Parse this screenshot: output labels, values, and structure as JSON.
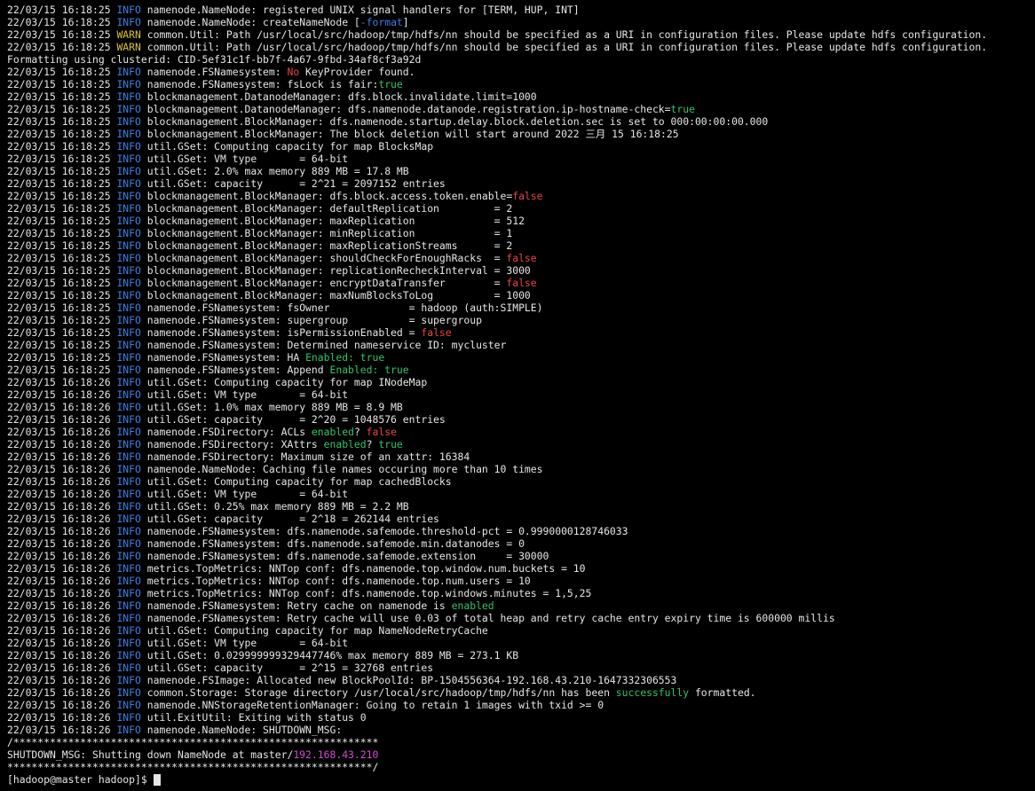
{
  "colors": {
    "background": "#000000",
    "text": "#e6e6e6",
    "info": "#3d7fe0",
    "warn": "#d8c43c",
    "true": "#2fc46a",
    "false": "#e64545",
    "ip": "#d24cd6"
  },
  "terminal": {
    "lines": [
      [
        {
          "t": "22/03/15 16:18:25 "
        },
        {
          "t": "INFO",
          "c": "info"
        },
        {
          "t": " namenode.NameNode: registered UNIX signal handlers for [TERM, HUP, INT]"
        }
      ],
      [
        {
          "t": "22/03/15 16:18:25 "
        },
        {
          "t": "INFO",
          "c": "info"
        },
        {
          "t": " namenode.NameNode: createNameNode ["
        },
        {
          "t": "-format",
          "c": "dash"
        },
        {
          "t": "]"
        }
      ],
      [
        {
          "t": "22/03/15 16:18:25 "
        },
        {
          "t": "WARN",
          "c": "warn"
        },
        {
          "t": " common.Util: Path /usr/local/src/hadoop/tmp/hdfs/nn should be specified as a URI in configuration files. Please update hdfs configuration."
        }
      ],
      [
        {
          "t": "22/03/15 16:18:25 "
        },
        {
          "t": "WARN",
          "c": "warn"
        },
        {
          "t": " common.Util: Path /usr/local/src/hadoop/tmp/hdfs/nn should be specified as a URI in configuration files. Please update hdfs configuration."
        }
      ],
      [
        {
          "t": "Formatting using clusterid: CID-5ef31c1f-bb7f-4a67-9fbd-34af8cf3a92d"
        }
      ],
      [
        {
          "t": "22/03/15 16:18:25 "
        },
        {
          "t": "INFO",
          "c": "info"
        },
        {
          "t": " namenode.FSNamesystem: "
        },
        {
          "t": "No",
          "c": "false"
        },
        {
          "t": " KeyProvider found."
        }
      ],
      [
        {
          "t": "22/03/15 16:18:25 "
        },
        {
          "t": "INFO",
          "c": "info"
        },
        {
          "t": " namenode.FSNamesystem: fsLock is fair:"
        },
        {
          "t": "true",
          "c": "true"
        }
      ],
      [
        {
          "t": "22/03/15 16:18:25 "
        },
        {
          "t": "INFO",
          "c": "info"
        },
        {
          "t": " blockmanagement.DatanodeManager: dfs.block.invalidate.limit=1000"
        }
      ],
      [
        {
          "t": "22/03/15 16:18:25 "
        },
        {
          "t": "INFO",
          "c": "info"
        },
        {
          "t": " blockmanagement.DatanodeManager: dfs.namenode.datanode.registration.ip-hostname-check="
        },
        {
          "t": "true",
          "c": "true"
        }
      ],
      [
        {
          "t": "22/03/15 16:18:25 "
        },
        {
          "t": "INFO",
          "c": "info"
        },
        {
          "t": " blockmanagement.BlockManager: dfs.namenode.startup.delay.block.deletion.sec is set to 000:00:00:00.000"
        }
      ],
      [
        {
          "t": "22/03/15 16:18:25 "
        },
        {
          "t": "INFO",
          "c": "info"
        },
        {
          "t": " blockmanagement.BlockManager: The block deletion will start around 2022 三月 15 16:18:25"
        }
      ],
      [
        {
          "t": "22/03/15 16:18:25 "
        },
        {
          "t": "INFO",
          "c": "info"
        },
        {
          "t": " util.GSet: Computing capacity for map BlocksMap"
        }
      ],
      [
        {
          "t": "22/03/15 16:18:25 "
        },
        {
          "t": "INFO",
          "c": "info"
        },
        {
          "t": " util.GSet: VM type       = 64-bit"
        }
      ],
      [
        {
          "t": "22/03/15 16:18:25 "
        },
        {
          "t": "INFO",
          "c": "info"
        },
        {
          "t": " util.GSet: 2.0% max memory 889 MB = 17.8 MB"
        }
      ],
      [
        {
          "t": "22/03/15 16:18:25 "
        },
        {
          "t": "INFO",
          "c": "info"
        },
        {
          "t": " util.GSet: capacity      = 2^21 = 2097152 entries"
        }
      ],
      [
        {
          "t": "22/03/15 16:18:25 "
        },
        {
          "t": "INFO",
          "c": "info"
        },
        {
          "t": " blockmanagement.BlockManager: dfs.block.access.token.enable="
        },
        {
          "t": "false",
          "c": "false"
        }
      ],
      [
        {
          "t": "22/03/15 16:18:25 "
        },
        {
          "t": "INFO",
          "c": "info"
        },
        {
          "t": " blockmanagement.BlockManager: defaultReplication         = 2"
        }
      ],
      [
        {
          "t": "22/03/15 16:18:25 "
        },
        {
          "t": "INFO",
          "c": "info"
        },
        {
          "t": " blockmanagement.BlockManager: maxReplication             = 512"
        }
      ],
      [
        {
          "t": "22/03/15 16:18:25 "
        },
        {
          "t": "INFO",
          "c": "info"
        },
        {
          "t": " blockmanagement.BlockManager: minReplication             = 1"
        }
      ],
      [
        {
          "t": "22/03/15 16:18:25 "
        },
        {
          "t": "INFO",
          "c": "info"
        },
        {
          "t": " blockmanagement.BlockManager: maxReplicationStreams      = 2"
        }
      ],
      [
        {
          "t": "22/03/15 16:18:25 "
        },
        {
          "t": "INFO",
          "c": "info"
        },
        {
          "t": " blockmanagement.BlockManager: shouldCheckForEnoughRacks  = "
        },
        {
          "t": "false",
          "c": "false"
        }
      ],
      [
        {
          "t": "22/03/15 16:18:25 "
        },
        {
          "t": "INFO",
          "c": "info"
        },
        {
          "t": " blockmanagement.BlockManager: replicationRecheckInterval = 3000"
        }
      ],
      [
        {
          "t": "22/03/15 16:18:25 "
        },
        {
          "t": "INFO",
          "c": "info"
        },
        {
          "t": " blockmanagement.BlockManager: encryptDataTransfer        = "
        },
        {
          "t": "false",
          "c": "false"
        }
      ],
      [
        {
          "t": "22/03/15 16:18:25 "
        },
        {
          "t": "INFO",
          "c": "info"
        },
        {
          "t": " blockmanagement.BlockManager: maxNumBlocksToLog          = 1000"
        }
      ],
      [
        {
          "t": "22/03/15 16:18:25 "
        },
        {
          "t": "INFO",
          "c": "info"
        },
        {
          "t": " namenode.FSNamesystem: fsOwner             = hadoop (auth:SIMPLE)"
        }
      ],
      [
        {
          "t": "22/03/15 16:18:25 "
        },
        {
          "t": "INFO",
          "c": "info"
        },
        {
          "t": " namenode.FSNamesystem: supergroup          = supergroup"
        }
      ],
      [
        {
          "t": "22/03/15 16:18:25 "
        },
        {
          "t": "INFO",
          "c": "info"
        },
        {
          "t": " namenode.FSNamesystem: isPermissionEnabled = "
        },
        {
          "t": "false",
          "c": "false"
        }
      ],
      [
        {
          "t": "22/03/15 16:18:25 "
        },
        {
          "t": "INFO",
          "c": "info"
        },
        {
          "t": " namenode.FSNamesystem: Determined nameservice ID: mycluster"
        }
      ],
      [
        {
          "t": "22/03/15 16:18:25 "
        },
        {
          "t": "INFO",
          "c": "info"
        },
        {
          "t": " namenode.FSNamesystem: HA "
        },
        {
          "t": "Enabled: true",
          "c": "true"
        }
      ],
      [
        {
          "t": "22/03/15 16:18:25 "
        },
        {
          "t": "INFO",
          "c": "info"
        },
        {
          "t": " namenode.FSNamesystem: Append "
        },
        {
          "t": "Enabled: true",
          "c": "true"
        }
      ],
      [
        {
          "t": "22/03/15 16:18:26 "
        },
        {
          "t": "INFO",
          "c": "info"
        },
        {
          "t": " util.GSet: Computing capacity for map INodeMap"
        }
      ],
      [
        {
          "t": "22/03/15 16:18:26 "
        },
        {
          "t": "INFO",
          "c": "info"
        },
        {
          "t": " util.GSet: VM type       = 64-bit"
        }
      ],
      [
        {
          "t": "22/03/15 16:18:26 "
        },
        {
          "t": "INFO",
          "c": "info"
        },
        {
          "t": " util.GSet: 1.0% max memory 889 MB = 8.9 MB"
        }
      ],
      [
        {
          "t": "22/03/15 16:18:26 "
        },
        {
          "t": "INFO",
          "c": "info"
        },
        {
          "t": " util.GSet: capacity      = 2^20 = 1048576 entries"
        }
      ],
      [
        {
          "t": "22/03/15 16:18:26 "
        },
        {
          "t": "INFO",
          "c": "info"
        },
        {
          "t": " namenode.FSDirectory: ACLs "
        },
        {
          "t": "enabled",
          "c": "true"
        },
        {
          "t": "? "
        },
        {
          "t": "false",
          "c": "false"
        }
      ],
      [
        {
          "t": "22/03/15 16:18:26 "
        },
        {
          "t": "INFO",
          "c": "info"
        },
        {
          "t": " namenode.FSDirectory: XAttrs "
        },
        {
          "t": "enabled",
          "c": "true"
        },
        {
          "t": "? "
        },
        {
          "t": "true",
          "c": "true"
        }
      ],
      [
        {
          "t": "22/03/15 16:18:26 "
        },
        {
          "t": "INFO",
          "c": "info"
        },
        {
          "t": " namenode.FSDirectory: Maximum size of an xattr: 16384"
        }
      ],
      [
        {
          "t": "22/03/15 16:18:26 "
        },
        {
          "t": "INFO",
          "c": "info"
        },
        {
          "t": " namenode.NameNode: Caching file names occuring more than 10 times"
        }
      ],
      [
        {
          "t": "22/03/15 16:18:26 "
        },
        {
          "t": "INFO",
          "c": "info"
        },
        {
          "t": " util.GSet: Computing capacity for map cachedBlocks"
        }
      ],
      [
        {
          "t": "22/03/15 16:18:26 "
        },
        {
          "t": "INFO",
          "c": "info"
        },
        {
          "t": " util.GSet: VM type       = 64-bit"
        }
      ],
      [
        {
          "t": "22/03/15 16:18:26 "
        },
        {
          "t": "INFO",
          "c": "info"
        },
        {
          "t": " util.GSet: 0.25% max memory 889 MB = 2.2 MB"
        }
      ],
      [
        {
          "t": "22/03/15 16:18:26 "
        },
        {
          "t": "INFO",
          "c": "info"
        },
        {
          "t": " util.GSet: capacity      = 2^18 = 262144 entries"
        }
      ],
      [
        {
          "t": "22/03/15 16:18:26 "
        },
        {
          "t": "INFO",
          "c": "info"
        },
        {
          "t": " namenode.FSNamesystem: dfs.namenode.safemode.threshold-pct = 0.9990000128746033"
        }
      ],
      [
        {
          "t": "22/03/15 16:18:26 "
        },
        {
          "t": "INFO",
          "c": "info"
        },
        {
          "t": " namenode.FSNamesystem: dfs.namenode.safemode.min.datanodes = 0"
        }
      ],
      [
        {
          "t": "22/03/15 16:18:26 "
        },
        {
          "t": "INFO",
          "c": "info"
        },
        {
          "t": " namenode.FSNamesystem: dfs.namenode.safemode.extension     = 30000"
        }
      ],
      [
        {
          "t": "22/03/15 16:18:26 "
        },
        {
          "t": "INFO",
          "c": "info"
        },
        {
          "t": " metrics.TopMetrics: NNTop conf: dfs.namenode.top.window.num.buckets = 10"
        }
      ],
      [
        {
          "t": "22/03/15 16:18:26 "
        },
        {
          "t": "INFO",
          "c": "info"
        },
        {
          "t": " metrics.TopMetrics: NNTop conf: dfs.namenode.top.num.users = 10"
        }
      ],
      [
        {
          "t": "22/03/15 16:18:26 "
        },
        {
          "t": "INFO",
          "c": "info"
        },
        {
          "t": " metrics.TopMetrics: NNTop conf: dfs.namenode.top.windows.minutes = 1,5,25"
        }
      ],
      [
        {
          "t": "22/03/15 16:18:26 "
        },
        {
          "t": "INFO",
          "c": "info"
        },
        {
          "t": " namenode.FSNamesystem: Retry cache on namenode is "
        },
        {
          "t": "enabled",
          "c": "true"
        }
      ],
      [
        {
          "t": "22/03/15 16:18:26 "
        },
        {
          "t": "INFO",
          "c": "info"
        },
        {
          "t": " namenode.FSNamesystem: Retry cache will use 0.03 of total heap and retry cache entry expiry time is 600000 millis"
        }
      ],
      [
        {
          "t": "22/03/15 16:18:26 "
        },
        {
          "t": "INFO",
          "c": "info"
        },
        {
          "t": " util.GSet: Computing capacity for map NameNodeRetryCache"
        }
      ],
      [
        {
          "t": "22/03/15 16:18:26 "
        },
        {
          "t": "INFO",
          "c": "info"
        },
        {
          "t": " util.GSet: VM type       = 64-bit"
        }
      ],
      [
        {
          "t": "22/03/15 16:18:26 "
        },
        {
          "t": "INFO",
          "c": "info"
        },
        {
          "t": " util.GSet: 0.029999999329447746% max memory 889 MB = 273.1 KB"
        }
      ],
      [
        {
          "t": "22/03/15 16:18:26 "
        },
        {
          "t": "INFO",
          "c": "info"
        },
        {
          "t": " util.GSet: capacity      = 2^15 = 32768 entries"
        }
      ],
      [
        {
          "t": "22/03/15 16:18:26 "
        },
        {
          "t": "INFO",
          "c": "info"
        },
        {
          "t": " namenode.FSImage: Allocated new BlockPoolId: BP-1504556364-192.168.43.210-1647332306553"
        }
      ],
      [
        {
          "t": "22/03/15 16:18:26 "
        },
        {
          "t": "INFO",
          "c": "info"
        },
        {
          "t": " common.Storage: Storage directory /usr/local/src/hadoop/tmp/hdfs/nn has been "
        },
        {
          "t": "successfully",
          "c": "true"
        },
        {
          "t": " formatted."
        }
      ],
      [
        {
          "t": "22/03/15 16:18:26 "
        },
        {
          "t": "INFO",
          "c": "info"
        },
        {
          "t": " namenode.NNStorageRetentionManager: Going to retain 1 images with txid >= 0"
        }
      ],
      [
        {
          "t": "22/03/15 16:18:26 "
        },
        {
          "t": "INFO",
          "c": "info"
        },
        {
          "t": " util.ExitUtil: Exiting with status 0"
        }
      ],
      [
        {
          "t": "22/03/15 16:18:26 "
        },
        {
          "t": "INFO",
          "c": "info"
        },
        {
          "t": " namenode.NameNode: SHUTDOWN_MSG:"
        }
      ],
      [
        {
          "t": "/************************************************************"
        }
      ],
      [
        {
          "t": "SHUTDOWN_MSG: Shutting down NameNode at master/"
        },
        {
          "t": "192.168.43.210",
          "c": "ip"
        }
      ],
      [
        {
          "t": "************************************************************/"
        }
      ]
    ],
    "prompt": "[hadoop@master hadoop]$ "
  }
}
